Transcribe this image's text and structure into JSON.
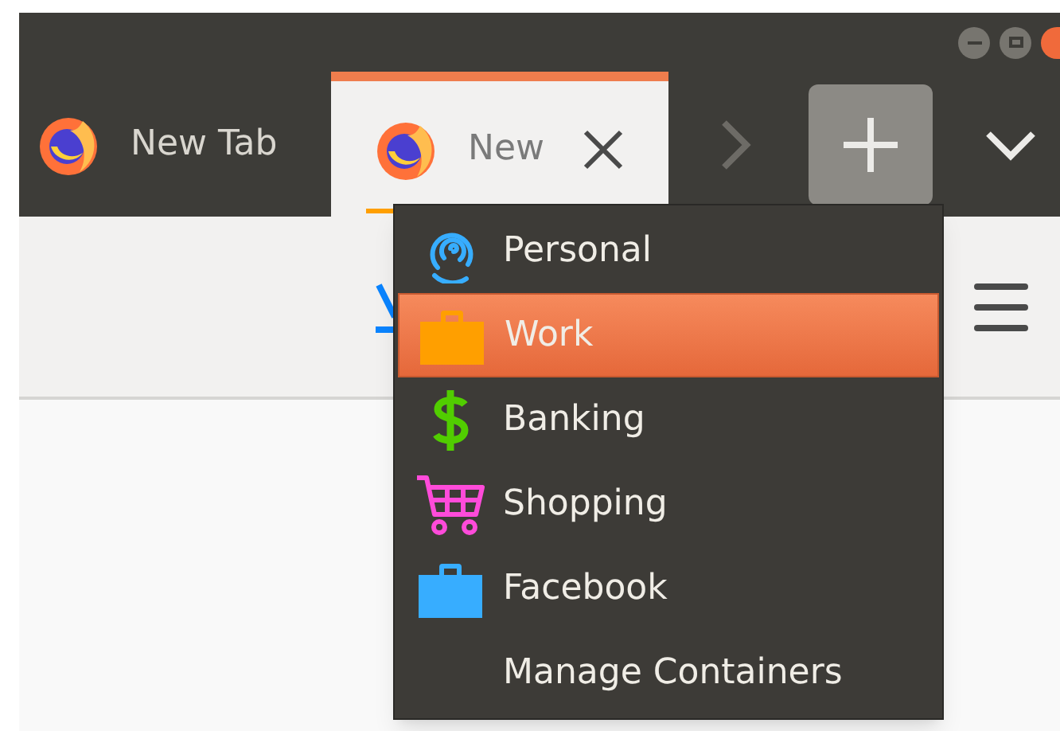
{
  "tabs": [
    {
      "label": "New Tab",
      "selected": false
    },
    {
      "label": "New",
      "selected": true
    }
  ],
  "menu": {
    "items": [
      {
        "kind": "fingerprint",
        "label": "Personal",
        "color": "#37adff",
        "selected": false
      },
      {
        "kind": "briefcase",
        "label": "Work",
        "color": "#ff9f00",
        "selected": true
      },
      {
        "kind": "dollar",
        "label": "Banking",
        "color": "#51cd00",
        "selected": false
      },
      {
        "kind": "cart",
        "label": "Shopping",
        "color": "#ff4bda",
        "selected": false
      },
      {
        "kind": "briefcase",
        "label": "Facebook",
        "color": "#37adff",
        "selected": false
      },
      {
        "kind": "plain",
        "label": "Manage Containers",
        "selected": false
      }
    ]
  }
}
